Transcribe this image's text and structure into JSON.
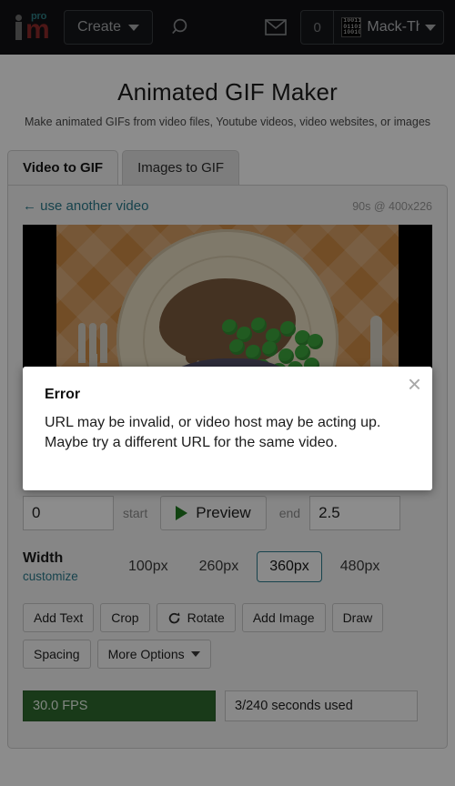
{
  "topnav": {
    "logo_text": "im",
    "logo_badge": "pro",
    "create_label": "Create",
    "search_icon": "search-icon",
    "mail_icon": "envelope-icon",
    "notification_count": "0",
    "avatar_pattern": "10011\n01101\n10010",
    "username": "Mack-Th",
    "background": "#111214"
  },
  "header": {
    "title": "Animated GIF Maker",
    "subtitle": "Make animated GIFs from video files, Youtube videos, video websites, or images"
  },
  "tabs": [
    {
      "label": "Video to GIF",
      "active": true
    },
    {
      "label": "Images to GIF",
      "active": false
    }
  ],
  "panel": {
    "use_another_video": "← use another video",
    "video_meta": "90s @ 400x226"
  },
  "timeline": {
    "start_marker": "start-marker",
    "end_marker": "end-marker",
    "selection_start_pct": 0,
    "selection_width_pct": 2
  },
  "trim": {
    "start_value": "0",
    "start_label": "start",
    "preview_label": "Preview",
    "end_label": "end",
    "end_value": "2.5"
  },
  "width": {
    "label": "Width",
    "customize_label": "customize",
    "options": [
      {
        "label": "100px",
        "selected": false
      },
      {
        "label": "260px",
        "selected": false
      },
      {
        "label": "360px",
        "selected": true
      },
      {
        "label": "480px",
        "selected": false
      }
    ],
    "selected_color": "#2b7b8c"
  },
  "tools_row1": [
    {
      "label": "Add Text",
      "icon": null
    },
    {
      "label": "Crop",
      "icon": null
    },
    {
      "label": "Rotate",
      "icon": "rotate-icon"
    },
    {
      "label": "Add Image",
      "icon": null
    },
    {
      "label": "Draw",
      "icon": null
    }
  ],
  "tools_row2": [
    {
      "label": "Spacing",
      "icon": null
    },
    {
      "label": "More Options",
      "icon": "chevron-down-icon"
    }
  ],
  "status": {
    "fps": "30.0 FPS",
    "fps_color": "#2f6b2f",
    "seconds_used": "3/240 seconds used"
  },
  "modal": {
    "title": "Error",
    "message": "URL may be invalid, or video host may be acting up. Maybe try a different URL for the same video.",
    "close_icon": "×"
  }
}
